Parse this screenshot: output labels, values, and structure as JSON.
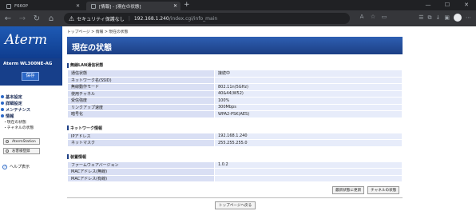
{
  "browser": {
    "tabs": [
      {
        "label": "F660P"
      },
      {
        "label": "[情報] - [現在の状態]"
      }
    ],
    "address": {
      "warning": "セキュリティ保護なし",
      "host": "192.168.1.240",
      "path": "/index.cgi/info_main"
    }
  },
  "sidebar": {
    "logo": "Aterm",
    "model": "Aterm  WL300NE-AG",
    "save_label": "保存",
    "menu": [
      {
        "label": "基本設定"
      },
      {
        "label": "詳細設定"
      },
      {
        "label": "メンテナンス"
      },
      {
        "label": "情報"
      }
    ],
    "submenu": [
      "・現在の状態",
      "・チャネルの状態"
    ],
    "buttons": [
      "AtermStation",
      "お客様登録"
    ],
    "help": "ヘルプ表示"
  },
  "main": {
    "breadcrumb": "トップページ > 情報 > 現在の状態",
    "title": "現在の状態",
    "sections": [
      {
        "heading": "無線LAN通信状態",
        "rows": [
          {
            "key": "通信状態",
            "value": "接続中"
          },
          {
            "key": "ネットワーク名(SSID)",
            "value": ""
          },
          {
            "key": "無線動作モード",
            "value": "802.11n(5GHz)"
          },
          {
            "key": "使用チャネル",
            "value": "40&44(W52)"
          },
          {
            "key": "受信強度",
            "value": "100%"
          },
          {
            "key": "リンクアップ速度",
            "value": "300Mbps"
          },
          {
            "key": "暗号化",
            "value": "WPA2-PSK(AES)"
          }
        ]
      },
      {
        "heading": "ネットワーク情報",
        "rows": [
          {
            "key": "IPアドレス",
            "value": "192.168.1.240"
          },
          {
            "key": "ネットマスク",
            "value": "255.255.255.0"
          }
        ]
      },
      {
        "heading": "装置情報",
        "rows": [
          {
            "key": "ファームウェアバージョン",
            "value": "1.0.2"
          },
          {
            "key": "MACアドレス(無線)",
            "value": ""
          },
          {
            "key": "MACアドレス(有線)",
            "value": ""
          }
        ]
      }
    ],
    "refresh_label": "最新状態に更新",
    "channel_label": "チャネルの状態",
    "top_label": "トップページへ戻る"
  }
}
